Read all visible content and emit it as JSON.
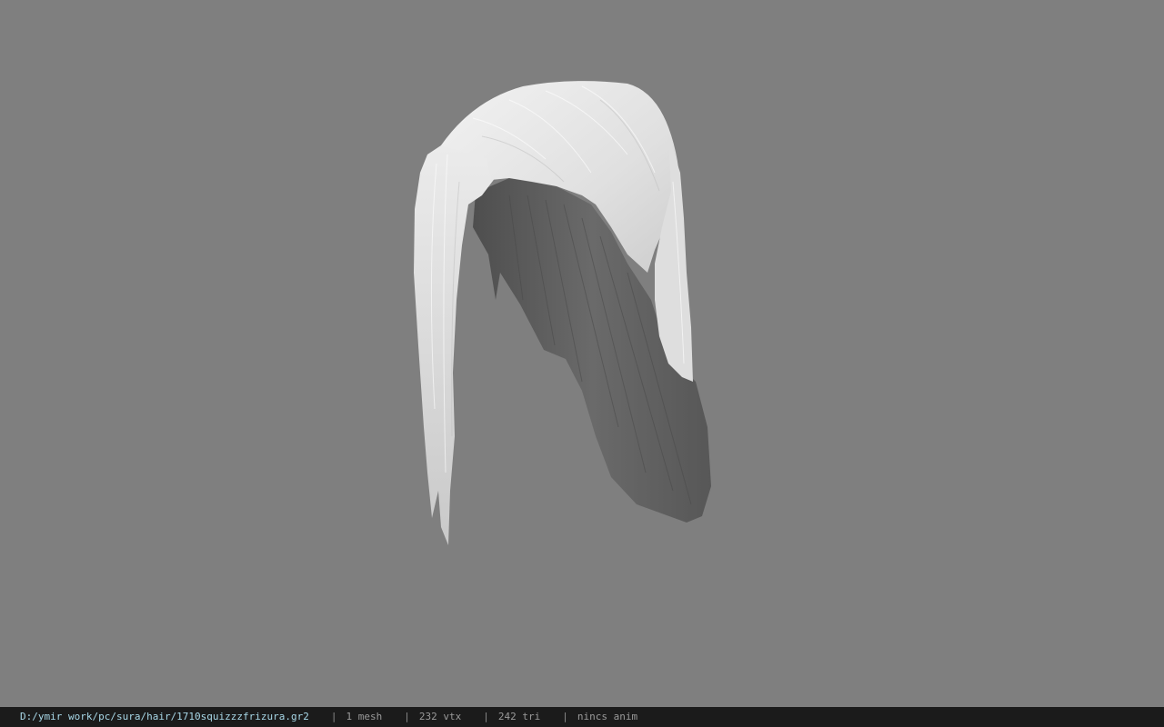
{
  "viewport": {
    "background_color": "#7f7f7f",
    "model": {
      "name": "hair-mesh",
      "front_color": "#e4e4e4",
      "inner_color": "#5e5e5e"
    }
  },
  "statusbar": {
    "file_path": "D:/ymir work/pc/sura/hair/1710squizzzfrizura.gr2",
    "separator": "|",
    "mesh_count": "1 mesh",
    "vertex_count": "232 vtx",
    "triangle_count": "242 tri",
    "anim_status": "nincs anim"
  }
}
